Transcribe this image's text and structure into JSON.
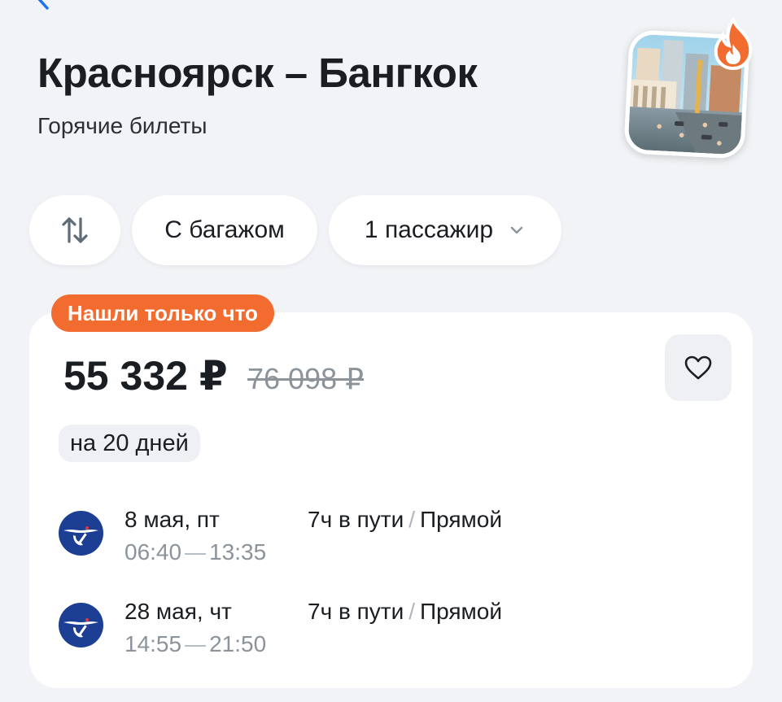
{
  "header": {
    "title": "Красноярск – Бангкок",
    "subtitle": "Горячие билеты"
  },
  "filters": {
    "swap_icon": "swap-vertical-arrows-icon",
    "baggage_label": "С багажом",
    "passengers_label": "1 пассажир"
  },
  "offer": {
    "badge": "Нашли только что",
    "price": "55 332 ₽",
    "old_price": "76 098 ₽",
    "duration": "на 20 дней",
    "segments": [
      {
        "date": "8 мая, пт",
        "depart": "06:40",
        "arrive": "13:35",
        "travel_time": "7ч в пути",
        "separator": "/",
        "stops": "Прямой"
      },
      {
        "date": "28 мая, чт",
        "depart": "14:55",
        "arrive": "21:50",
        "travel_time": "7ч в пути",
        "separator": "/",
        "stops": "Прямой"
      }
    ]
  },
  "colors": {
    "accent_orange": "#f26b2f",
    "airline_blue": "#1c3f94",
    "background": "#f1f3f6"
  }
}
